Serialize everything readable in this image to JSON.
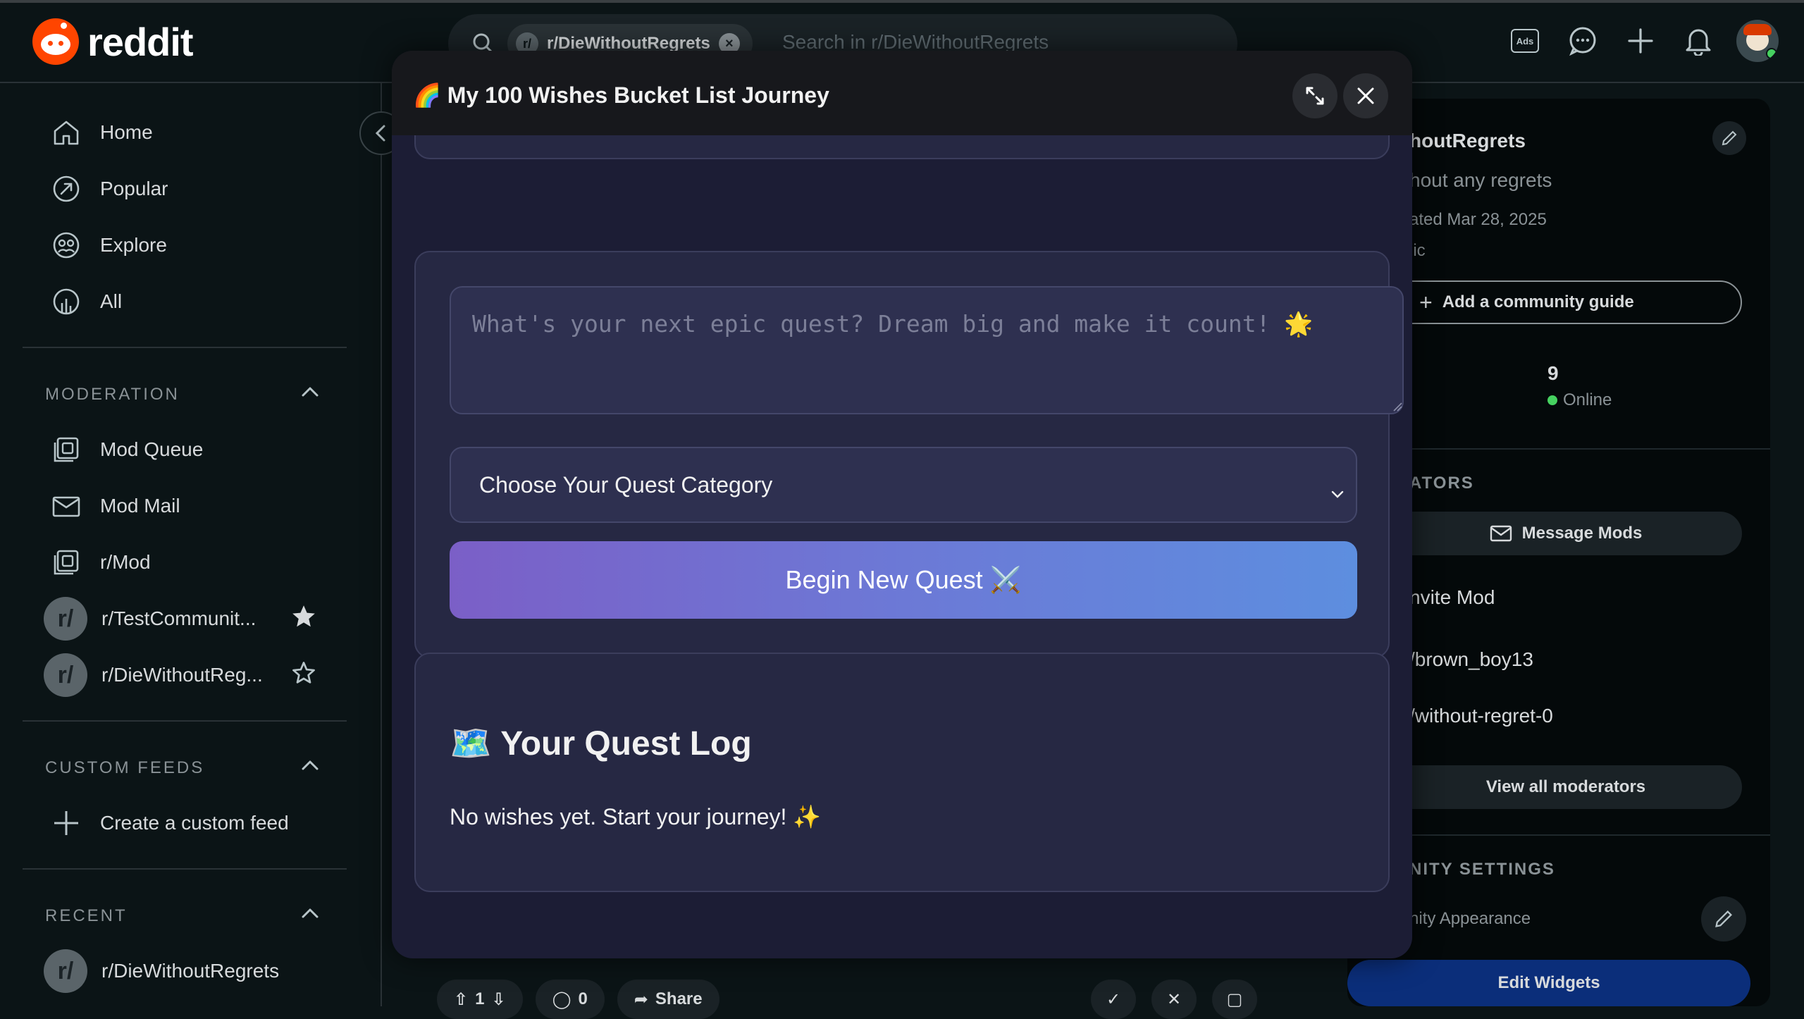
{
  "header": {
    "logo_text": "reddit",
    "search_chip": "r/DieWithoutRegrets",
    "search_placeholder": "Search in r/DieWithoutRegrets",
    "ads_label": "Ads"
  },
  "sidebar": {
    "nav": [
      {
        "label": "Home",
        "icon": "home-icon"
      },
      {
        "label": "Popular",
        "icon": "popular-icon"
      },
      {
        "label": "Explore",
        "icon": "explore-icon"
      },
      {
        "label": "All",
        "icon": "all-icon"
      }
    ],
    "moderation_title": "MODERATION",
    "moderation": [
      {
        "label": "Mod Queue",
        "icon": "mod-queue-icon"
      },
      {
        "label": "Mod Mail",
        "icon": "mod-mail-icon"
      },
      {
        "label": "r/Mod",
        "icon": "mod-icon"
      },
      {
        "label": "r/TestCommunit...",
        "icon": "subreddit-icon",
        "favorite": true
      },
      {
        "label": "r/DieWithoutReg...",
        "icon": "subreddit-icon",
        "favorite": false
      }
    ],
    "custom_feeds_title": "CUSTOM FEEDS",
    "create_feed": "Create a custom feed",
    "recent_title": "RECENT",
    "recent": [
      {
        "label": "r/DieWithoutRegrets"
      }
    ]
  },
  "post_bar": {
    "vote_count": "1",
    "comment_count": "0",
    "share_label": "Share"
  },
  "right_sidebar": {
    "title": "houtRegrets",
    "subtitle": "hout any regrets",
    "created": "ated Mar 28, 2025",
    "visibility": "lic",
    "add_guide": "Add a community guide",
    "online_count": "9",
    "online_label": "Online",
    "moderators_heading": "ATORS",
    "message_mods": "Message Mods",
    "invite_mod": "nvite Mod",
    "moderators": [
      "/brown_boy13",
      "/without-regret-0"
    ],
    "view_all": "View all moderators",
    "settings_heading": "NITY SETTINGS",
    "appearance": "nity Appearance",
    "edit_widgets": "Edit Widgets"
  },
  "modal": {
    "title": "🌈 My 100 Wishes Bucket List Journey",
    "textarea_placeholder": "What's your next epic quest? Dream big and make it count! 🌟",
    "select_value": "Choose Your Quest Category",
    "submit_label": "Begin New Quest ⚔️",
    "log_title": "🗺️ Your Quest Log",
    "log_empty": "No wishes yet. Start your journey! ✨"
  },
  "colors": {
    "reddit_orange": "#ff4500",
    "modal_bg": "#1c1d35",
    "button_gradient_start": "#7b5fc7",
    "button_gradient_end": "#5d8edf",
    "online_green": "#46d160",
    "edit_widgets_bg": "#0b2e7a"
  }
}
